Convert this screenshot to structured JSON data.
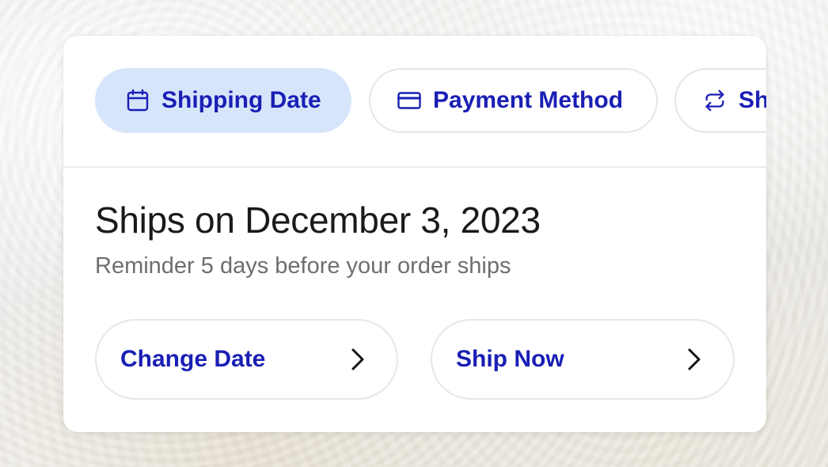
{
  "tabs": [
    {
      "label": "Shipping Date",
      "icon": "calendar-icon",
      "active": true
    },
    {
      "label": "Payment Method",
      "icon": "credit-card-icon",
      "active": false
    },
    {
      "label": "Sh",
      "icon": "repeat-icon",
      "active": false
    }
  ],
  "shipment": {
    "heading": "Ships on December 3, 2023",
    "subtext": "Reminder 5 days before your order ships"
  },
  "actions": [
    {
      "label": "Change Date",
      "icon": "chevron-right-icon"
    },
    {
      "label": "Ship Now",
      "icon": "chevron-right-icon"
    }
  ],
  "colors": {
    "accent": "#1a1fb5",
    "active_tab_bg": "#d6e5fa",
    "heading": "#1a1a1a",
    "subtext": "#6e6e6e"
  }
}
